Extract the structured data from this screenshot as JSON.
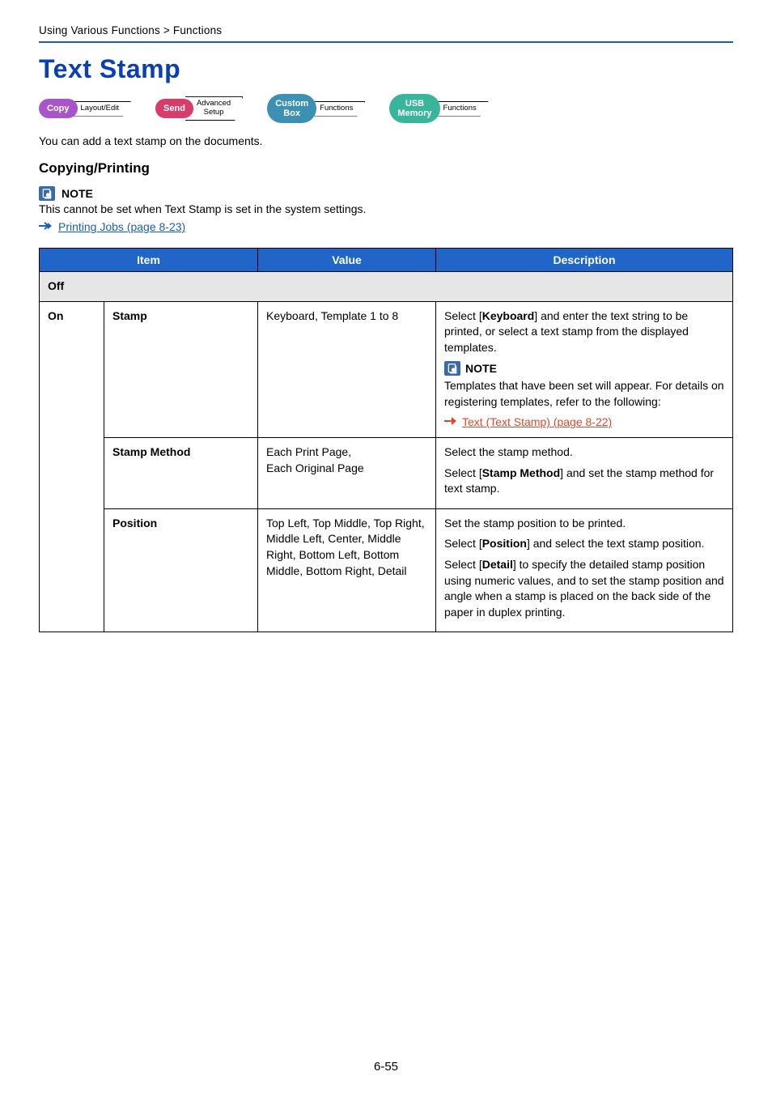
{
  "breadcrumb": "Using Various Functions > Functions",
  "title": "Text Stamp",
  "pills": {
    "copy": {
      "label": "Copy",
      "tag_line1": "Layout/Edit",
      "tag_line2": ""
    },
    "send": {
      "label": "Send",
      "tag_line1": "Advanced",
      "tag_line2": "Setup"
    },
    "custom": {
      "label_line1": "Custom",
      "label_line2": "Box",
      "tag_line1": "Functions",
      "tag_line2": ""
    },
    "usb": {
      "label_line1": "USB",
      "label_line2": "Memory",
      "tag_line1": "Functions",
      "tag_line2": ""
    }
  },
  "intro": "You can add a text stamp on the documents.",
  "section_heading": "Copying/Printing",
  "note": {
    "label": "NOTE",
    "body": "This cannot be set when Text Stamp is set in the system settings."
  },
  "top_xref": "Printing Jobs (page 8-23)",
  "table": {
    "headers": {
      "item": "Item",
      "value": "Value",
      "description": "Description"
    },
    "off_label": "Off",
    "on_label": "On",
    "rows": {
      "stamp": {
        "item": "Stamp",
        "value": "Keyboard, Template 1 to 8",
        "desc_main_pre": "Select [",
        "desc_main_bold": "Keyboard",
        "desc_main_post": "] and enter the text string to be printed, or select a text stamp from the displayed templates.",
        "note_label": "NOTE",
        "note_body": "Templates that have been set will appear. For details on registering templates, refer to the following:",
        "xref": "Text (Text Stamp) (page 8-22)"
      },
      "stamp_method": {
        "item": "Stamp Method",
        "value_line1": "Each Print Page,",
        "value_line2": "Each Original Page",
        "desc_line1": "Select the stamp method.",
        "desc_pre": "Select [",
        "desc_bold": "Stamp Method",
        "desc_post": "] and set the stamp method for text stamp."
      },
      "position": {
        "item": "Position",
        "value": "Top Left, Top Middle, Top Right, Middle Left, Center, Middle Right, Bottom Left, Bottom Middle, Bottom Right, Detail",
        "desc_line1": "Set the stamp position to be printed.",
        "desc2_pre": "Select [",
        "desc2_bold": "Position",
        "desc2_post": "] and select the text stamp position.",
        "desc3_pre": "Select [",
        "desc3_bold": "Detail",
        "desc3_post": "] to specify the detailed stamp position using numeric values, and to set the stamp position and angle when a stamp is placed on the back side of the paper in duplex printing."
      }
    }
  },
  "page_number": "6-55"
}
